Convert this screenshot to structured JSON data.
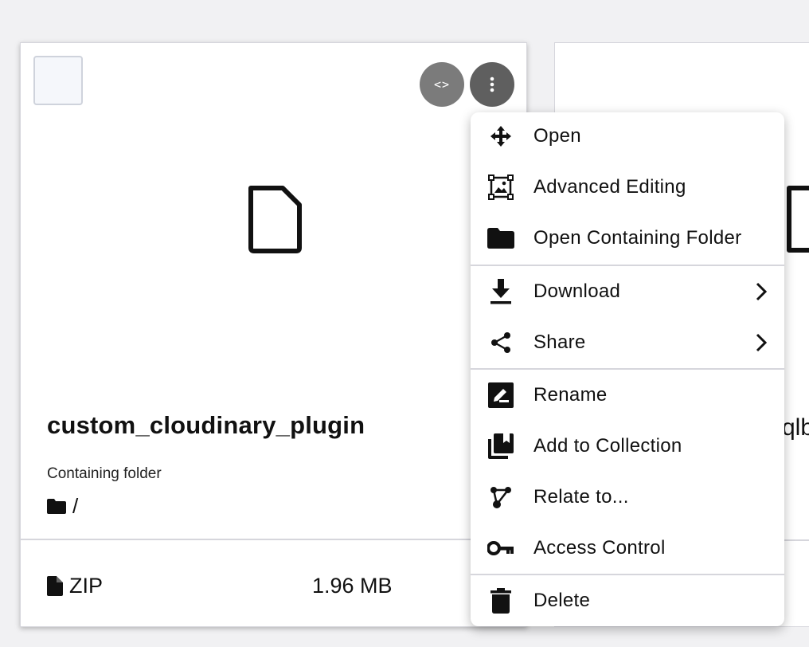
{
  "card": {
    "file_name": "custom_cloudinary_plugin",
    "folder_label": "Containing folder",
    "folder_path": "/",
    "file_type": "ZIP",
    "file_size": "1.96 MB",
    "code_button_glyph": "<>"
  },
  "card2": {
    "partial_name": "qlb"
  },
  "menu": {
    "items": [
      {
        "label": "Open",
        "icon": "move-icon"
      },
      {
        "label": "Advanced Editing",
        "icon": "image-edit-icon"
      },
      {
        "label": "Open Containing Folder",
        "icon": "folder-icon"
      },
      {
        "label": "Download",
        "icon": "download-icon",
        "submenu": true
      },
      {
        "label": "Share",
        "icon": "share-icon",
        "submenu": true
      },
      {
        "label": "Rename",
        "icon": "rename-icon"
      },
      {
        "label": "Add to Collection",
        "icon": "collection-icon"
      },
      {
        "label": "Relate to...",
        "icon": "relate-icon"
      },
      {
        "label": "Access Control",
        "icon": "key-icon"
      },
      {
        "label": "Delete",
        "icon": "trash-icon"
      }
    ]
  },
  "colors": {
    "code_button": "#7b7b7b",
    "more_button": "#5f5f5f",
    "separator": "#d6d6dc"
  }
}
